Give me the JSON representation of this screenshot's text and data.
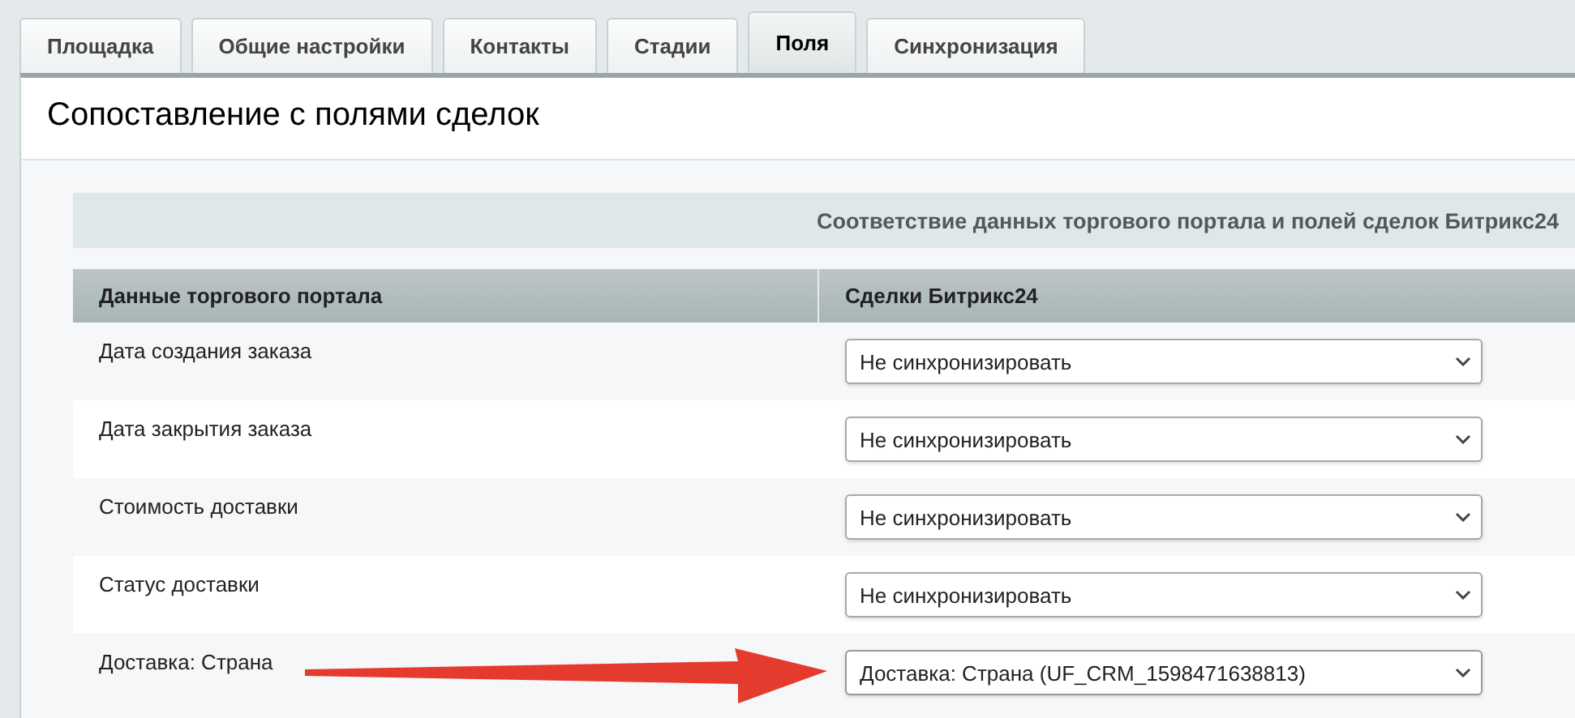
{
  "tabs": [
    {
      "label": "Площадка",
      "selected": false
    },
    {
      "label": "Общие настройки",
      "selected": false
    },
    {
      "label": "Контакты",
      "selected": false
    },
    {
      "label": "Стадии",
      "selected": false
    },
    {
      "label": "Поля",
      "selected": true
    },
    {
      "label": "Синхронизация",
      "selected": false
    }
  ],
  "panel": {
    "title": "Сопоставление с полями сделок",
    "table": {
      "caption": "Соответствие данных торгового портала и полей сделок Битрикс24",
      "columns": [
        "Данные торгового портала",
        "Сделки Битрикс24"
      ],
      "rows": [
        {
          "field": "Дата создания заказа",
          "value": "Не синхронизировать",
          "highlighted": false
        },
        {
          "field": "Дата закрытия заказа",
          "value": "Не синхронизировать",
          "highlighted": false
        },
        {
          "field": "Стоимость доставки",
          "value": "Не синхронизировать",
          "highlighted": false
        },
        {
          "field": "Статус доставки",
          "value": "Не синхронизировать",
          "highlighted": false
        },
        {
          "field": "Доставка: Страна",
          "value": "Доставка: Страна (UF_CRM_1598471638813)",
          "highlighted": true
        }
      ]
    }
  }
}
